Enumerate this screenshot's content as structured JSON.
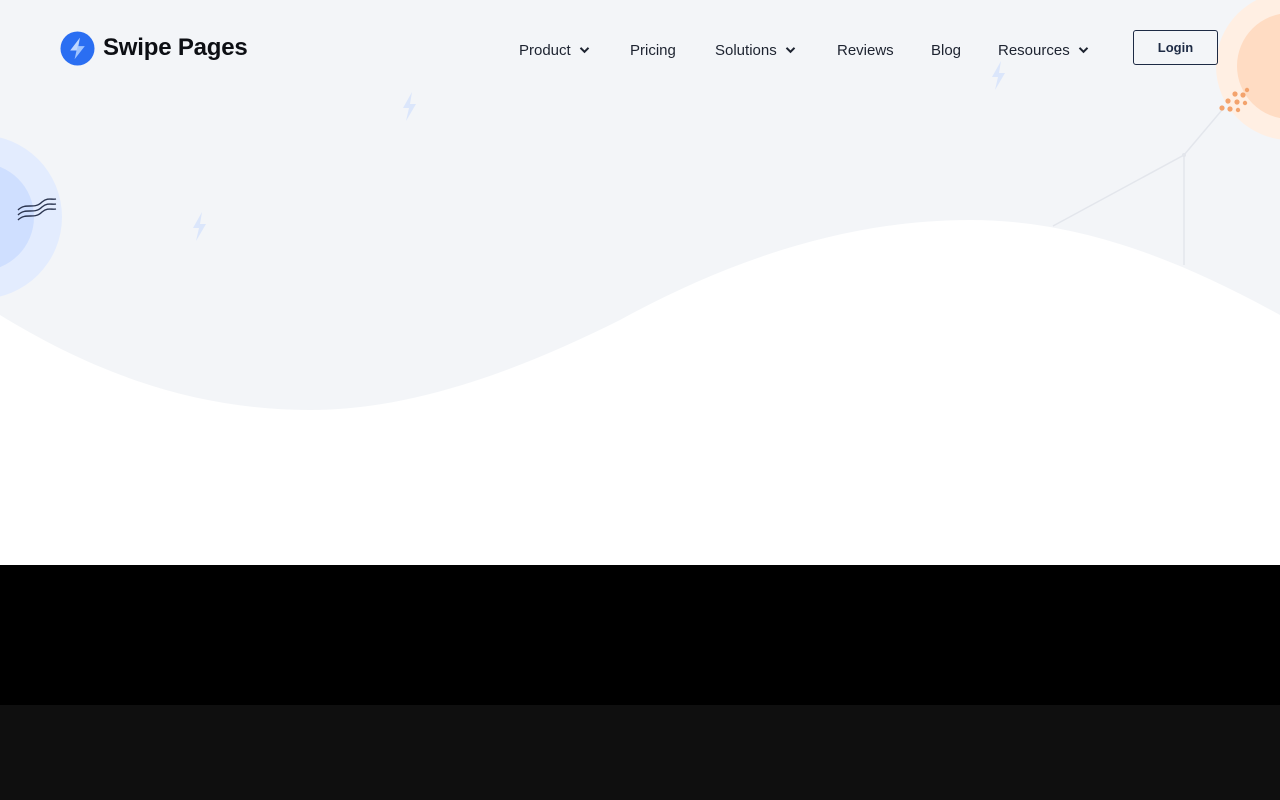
{
  "brand": {
    "name": "Swipe Pages",
    "logo_icon": "lightning-bolt-icon",
    "accent_color": "#2a6ef2"
  },
  "nav": {
    "items": [
      {
        "label": "Product",
        "has_dropdown": true
      },
      {
        "label": "Pricing",
        "has_dropdown": false
      },
      {
        "label": "Solutions",
        "has_dropdown": true
      },
      {
        "label": "Reviews",
        "has_dropdown": false
      },
      {
        "label": "Blog",
        "has_dropdown": false
      },
      {
        "label": "Resources",
        "has_dropdown": true
      }
    ],
    "login_label": "Login"
  },
  "colors": {
    "hero_background": "#f3f5f8",
    "hero_wave": "#ffffff",
    "decor_blue": "#cfe0ff",
    "decor_orange": "#ffe3cf",
    "footer_band_1": "#000000",
    "footer_band_2": "#0f0f0f"
  }
}
